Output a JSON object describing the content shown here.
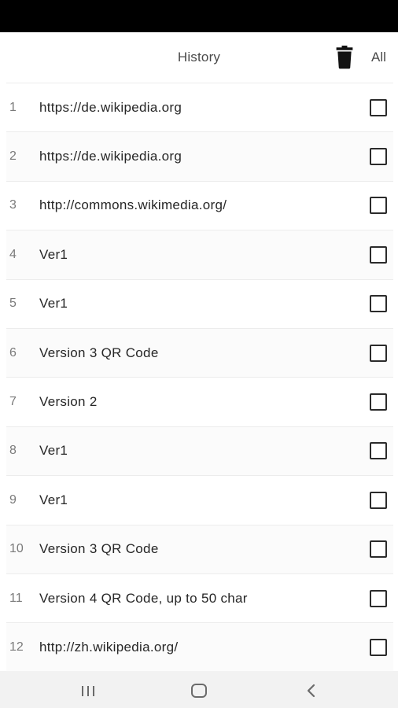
{
  "header": {
    "title": "History",
    "select_all_label": "All",
    "delete_icon": "trash-icon"
  },
  "history": [
    {
      "index": "1",
      "text": "https://de.wikipedia.org",
      "checked": false
    },
    {
      "index": "2",
      "text": "https://de.wikipedia.org",
      "checked": false
    },
    {
      "index": "3",
      "text": "http://commons.wikimedia.org/",
      "checked": false
    },
    {
      "index": "4",
      "text": "Ver1",
      "checked": false
    },
    {
      "index": "5",
      "text": "Ver1",
      "checked": false
    },
    {
      "index": "6",
      "text": "Version 3 QR Code",
      "checked": false
    },
    {
      "index": "7",
      "text": "Version 2",
      "checked": false
    },
    {
      "index": "8",
      "text": "Ver1",
      "checked": false
    },
    {
      "index": "9",
      "text": "Ver1",
      "checked": false
    },
    {
      "index": "10",
      "text": "Version 3 QR Code",
      "checked": false
    },
    {
      "index": "11",
      "text": "Version 4 QR Code, up to 50 char",
      "checked": false
    },
    {
      "index": "12",
      "text": "http://zh.wikipedia.org/",
      "checked": false
    }
  ],
  "nav": {
    "recents_icon": "recents-icon",
    "home_icon": "home-icon",
    "back_icon": "back-icon"
  },
  "colors": {
    "status_bar": "#000000",
    "nav_bar": "#f2f2f2",
    "divider": "#ececec"
  }
}
